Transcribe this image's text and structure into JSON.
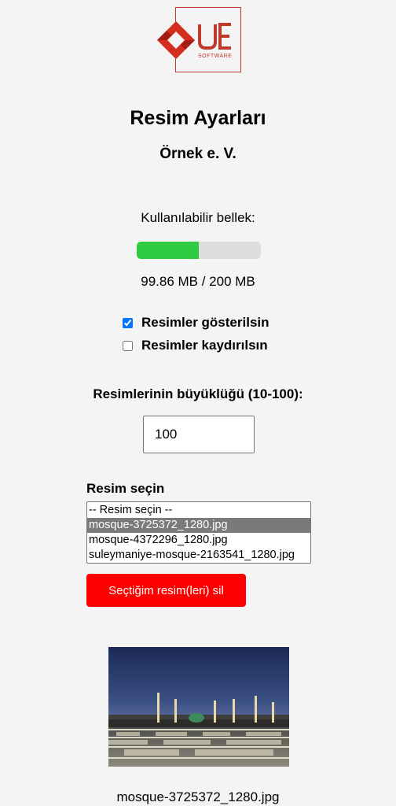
{
  "logo": {
    "mark": "UE",
    "sub": "SOFTWARE",
    "icon": "ue-software-logo",
    "color": "#c0392b"
  },
  "page": {
    "title": "Resim Ayarları",
    "organization": "Örnek e. V."
  },
  "memory": {
    "label": "Kullanılabilir bellek:",
    "used_mb": 99.86,
    "total_mb": 200,
    "value_text": "99.86 MB / 200 MB",
    "bar_color": "#2ecc40"
  },
  "options": {
    "show_images_label": "Resimler gösterilsin",
    "show_images_checked": true,
    "scroll_images_label": "Resimler kaydırılsın",
    "scroll_images_checked": false
  },
  "size": {
    "label": "Resimlerinin büyüklüğü (10-100):",
    "value": "100"
  },
  "picker": {
    "label": "Resim seçin",
    "options": [
      "-- Resim seçin --",
      "mosque-3725372_1280.jpg",
      "mosque-4372296_1280.jpg",
      "suleymaniye-mosque-2163541_1280.jpg"
    ],
    "selected_index": 1
  },
  "delete_button": {
    "label": "Seçtiğim resim(leri) sil",
    "color": "#ff0000"
  },
  "preview": {
    "caption": "mosque-3725372_1280.jpg"
  }
}
